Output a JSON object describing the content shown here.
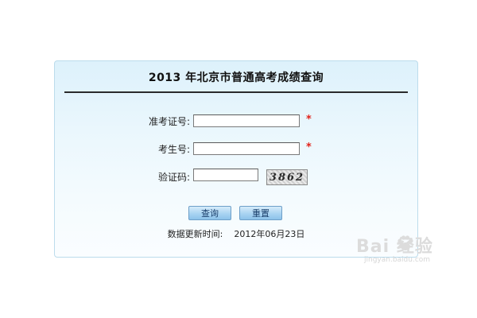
{
  "page": {
    "title": "2013 年北京市普通高考成绩查询"
  },
  "form": {
    "exam_number_label": "准考证号:",
    "exam_number_value": "",
    "student_number_label": "考生号:",
    "student_number_value": "",
    "captcha_label": "验证码:",
    "captcha_value": "",
    "captcha_text": "3862",
    "required_mark": "*"
  },
  "actions": {
    "query_label": "查询",
    "reset_label": "重置"
  },
  "update": {
    "label": "数据更新时间:",
    "date": "2012年06月23日"
  },
  "watermark": {
    "brand": "Bai  经验",
    "url": "jingyan.baidu.com"
  },
  "colors": {
    "panel_bg": "#eaf7fd",
    "panel_border": "#bcdcec",
    "required": "#e2231a",
    "button": "#a9d3f2"
  }
}
